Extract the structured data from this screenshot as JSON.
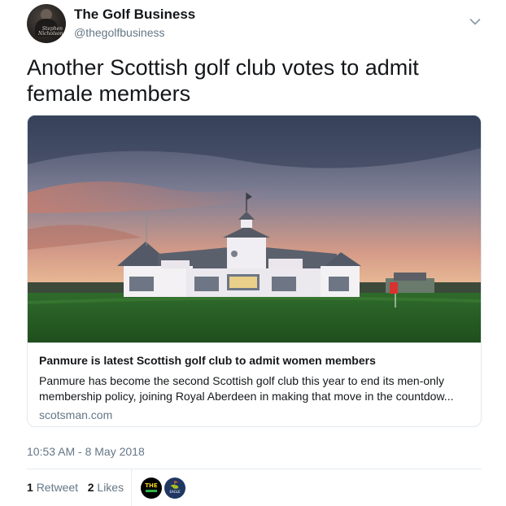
{
  "author": {
    "display_name": "The Golf Business",
    "handle": "@thegolfbusiness",
    "avatar_signature": "Stephen\nNicholson"
  },
  "tweet": {
    "text": "Another Scottish golf club votes to admit female members",
    "timestamp": "10:53 AM - 8 May 2018"
  },
  "card": {
    "image_alt": "Panmure golf clubhouse at sunset",
    "title": "Panmure is latest Scottish golf club to admit women members",
    "description": "Panmure has become the second Scottish golf club this year to end its men-only membership policy, joining Royal Aberdeen in making that move in the countdow...",
    "domain": "scotsman.com"
  },
  "stats": {
    "retweet_count": "1",
    "retweet_label": "Retweet",
    "like_count": "2",
    "like_label": "Likes"
  },
  "likers": [
    {
      "name": "the-golf-business-avatar",
      "text": "THE"
    },
    {
      "name": "eagle-avatar",
      "glyph": "⛳",
      "text": "EAGLE"
    }
  ],
  "icons": {
    "caret": "chevron-down-icon"
  }
}
